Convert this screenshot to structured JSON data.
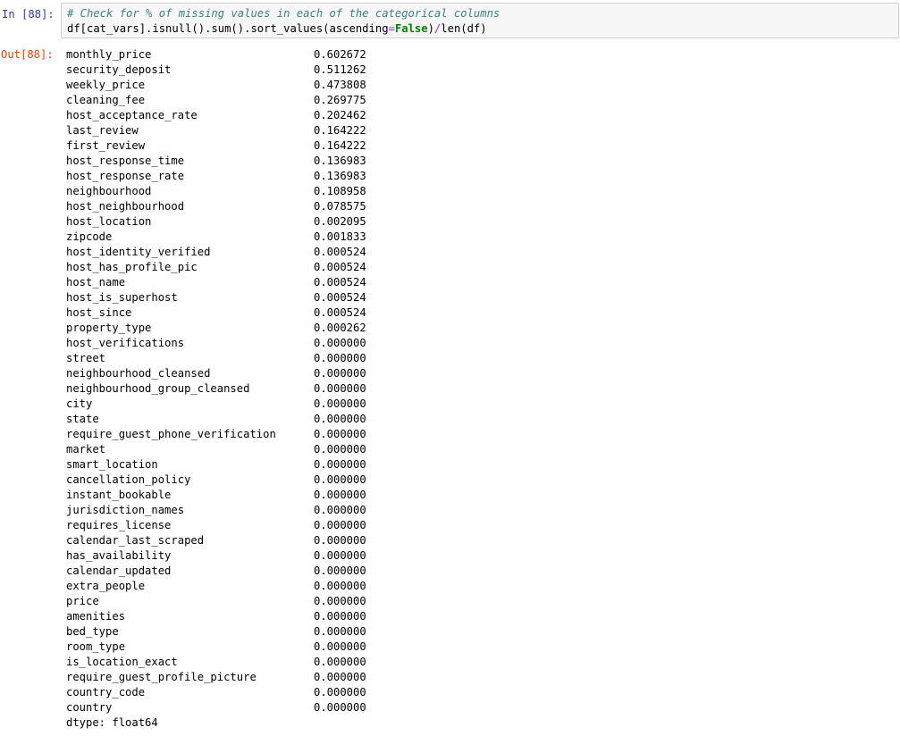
{
  "input_cell": {
    "prompt": "In [88]:",
    "comment": "# Check for % of missing values in each of the categorical columns",
    "code_parts": {
      "p1": "df[cat_vars].isnull().sum().sort_values(ascending",
      "eq": "=",
      "kw": "False",
      "p2": ")",
      "div": "/",
      "p3": "len(df)"
    }
  },
  "output_cell": {
    "prompt": "Out[88]:",
    "rows": [
      {
        "name": "monthly_price",
        "value": "0.602672"
      },
      {
        "name": "security_deposit",
        "value": "0.511262"
      },
      {
        "name": "weekly_price",
        "value": "0.473808"
      },
      {
        "name": "cleaning_fee",
        "value": "0.269775"
      },
      {
        "name": "host_acceptance_rate",
        "value": "0.202462"
      },
      {
        "name": "last_review",
        "value": "0.164222"
      },
      {
        "name": "first_review",
        "value": "0.164222"
      },
      {
        "name": "host_response_time",
        "value": "0.136983"
      },
      {
        "name": "host_response_rate",
        "value": "0.136983"
      },
      {
        "name": "neighbourhood",
        "value": "0.108958"
      },
      {
        "name": "host_neighbourhood",
        "value": "0.078575"
      },
      {
        "name": "host_location",
        "value": "0.002095"
      },
      {
        "name": "zipcode",
        "value": "0.001833"
      },
      {
        "name": "host_identity_verified",
        "value": "0.000524"
      },
      {
        "name": "host_has_profile_pic",
        "value": "0.000524"
      },
      {
        "name": "host_name",
        "value": "0.000524"
      },
      {
        "name": "host_is_superhost",
        "value": "0.000524"
      },
      {
        "name": "host_since",
        "value": "0.000524"
      },
      {
        "name": "property_type",
        "value": "0.000262"
      },
      {
        "name": "host_verifications",
        "value": "0.000000"
      },
      {
        "name": "street",
        "value": "0.000000"
      },
      {
        "name": "neighbourhood_cleansed",
        "value": "0.000000"
      },
      {
        "name": "neighbourhood_group_cleansed",
        "value": "0.000000"
      },
      {
        "name": "city",
        "value": "0.000000"
      },
      {
        "name": "state",
        "value": "0.000000"
      },
      {
        "name": "require_guest_phone_verification",
        "value": "0.000000"
      },
      {
        "name": "market",
        "value": "0.000000"
      },
      {
        "name": "smart_location",
        "value": "0.000000"
      },
      {
        "name": "cancellation_policy",
        "value": "0.000000"
      },
      {
        "name": "instant_bookable",
        "value": "0.000000"
      },
      {
        "name": "jurisdiction_names",
        "value": "0.000000"
      },
      {
        "name": "requires_license",
        "value": "0.000000"
      },
      {
        "name": "calendar_last_scraped",
        "value": "0.000000"
      },
      {
        "name": "has_availability",
        "value": "0.000000"
      },
      {
        "name": "calendar_updated",
        "value": "0.000000"
      },
      {
        "name": "extra_people",
        "value": "0.000000"
      },
      {
        "name": "price",
        "value": "0.000000"
      },
      {
        "name": "amenities",
        "value": "0.000000"
      },
      {
        "name": "bed_type",
        "value": "0.000000"
      },
      {
        "name": "room_type",
        "value": "0.000000"
      },
      {
        "name": "is_location_exact",
        "value": "0.000000"
      },
      {
        "name": "require_guest_profile_picture",
        "value": "0.000000"
      },
      {
        "name": "country_code",
        "value": "0.000000"
      },
      {
        "name": "country",
        "value": "0.000000"
      }
    ],
    "dtype": "dtype: float64"
  }
}
